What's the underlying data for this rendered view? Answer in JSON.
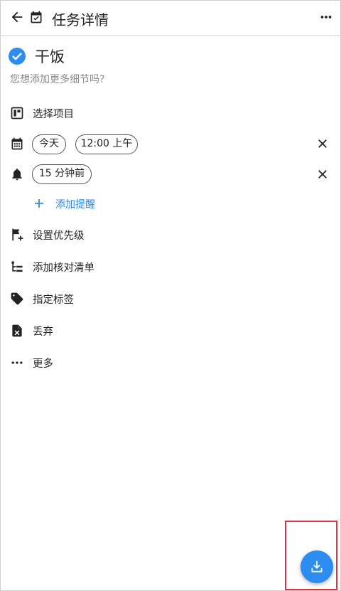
{
  "header": {
    "title": "任务详情",
    "back_icon": "arrow-left-icon",
    "calendar_icon": "calendar-check-icon",
    "more_icon": "more-horizontal-icon"
  },
  "task": {
    "title": "干饭",
    "completed": true,
    "description_placeholder": "您想添加更多细节吗?",
    "accent_color": "#2d8cf0"
  },
  "project": {
    "label": "选择项目",
    "icon": "project-board-icon"
  },
  "date": {
    "icon": "calendar-icon",
    "day_chip": "今天",
    "time_chip": "12:00 上午",
    "clear_icon": "close-icon"
  },
  "reminder": {
    "icon": "bell-icon",
    "chip": "15 分钟前",
    "clear_icon": "close-icon",
    "add_label": "添加提醒",
    "add_color": "#2f86e6"
  },
  "actions": [
    {
      "label": "设置优先级",
      "icon": "flag-add-icon"
    },
    {
      "label": "添加核对清单",
      "icon": "checklist-tree-icon"
    },
    {
      "label": "指定标签",
      "icon": "tag-icon"
    },
    {
      "label": "丢弃",
      "icon": "delete-file-icon"
    },
    {
      "label": "更多",
      "icon": "more-horizontal-icon"
    }
  ],
  "fab": {
    "icon": "download-tray-icon",
    "color": "#2d8cf0"
  }
}
